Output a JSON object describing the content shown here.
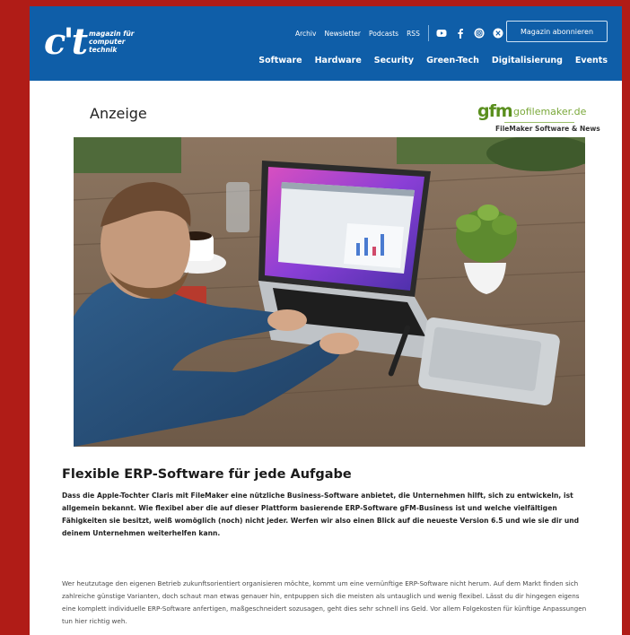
{
  "site": {
    "logo_mark": "c't",
    "logo_tagline": [
      "magazin für",
      "computer",
      "technik"
    ]
  },
  "header": {
    "utility_links": [
      "Archiv",
      "Newsletter",
      "Podcasts",
      "RSS"
    ],
    "social_icons": [
      "youtube-icon",
      "facebook-icon",
      "instagram-icon",
      "x-icon"
    ],
    "subscribe_label": "Magazin abonnieren",
    "nav_items": [
      "Software",
      "Hardware",
      "Security",
      "Green-Tech",
      "Digitalisierung",
      "Events"
    ]
  },
  "ad": {
    "label": "Anzeige",
    "sponsor_brand": "gfm",
    "sponsor_domain": "gofilemaker.de",
    "sponsor_subline": "FileMaker Software & News"
  },
  "article": {
    "title": "Flexible ERP-Software für jede Aufgabe",
    "lead": "Dass die Apple-Tochter Claris mit FileMaker eine nützliche Business-Software anbietet, die Unternehmen hilft, sich zu entwickeln, ist allgemein bekannt. Wie flexibel aber die auf dieser Plattform basierende ERP-Software gFM-Business ist und welche vielfältigen Fähigkeiten sie besitzt, weiß womöglich (noch) nicht jeder. Werfen wir also einen Blick auf die neueste Version 6.5 und wie sie dir und deinem Unternehmen weiterhelfen kann.",
    "body": "Wer heutzutage den eigenen Betrieb zukunftsorientiert organisieren möchte, kommt um eine vernünftige ERP-Software nicht herum. Auf dem Markt finden sich zahlreiche günstige Varianten, doch schaut man etwas genauer hin, entpuppen sich die meisten als untauglich und wenig flexibel. Lässt du dir hingegen eigens eine komplett individuelle ERP-Software anfertigen, maßgeschneidert sozusagen, geht dies sehr schnell ins Geld. Vor allem Folgekosten für künftige Anpassungen tun hier richtig weh."
  },
  "colors": {
    "page_border": "#b01c17",
    "header_bg": "#0f5ea8",
    "sponsor_green": "#5a8f1e"
  }
}
